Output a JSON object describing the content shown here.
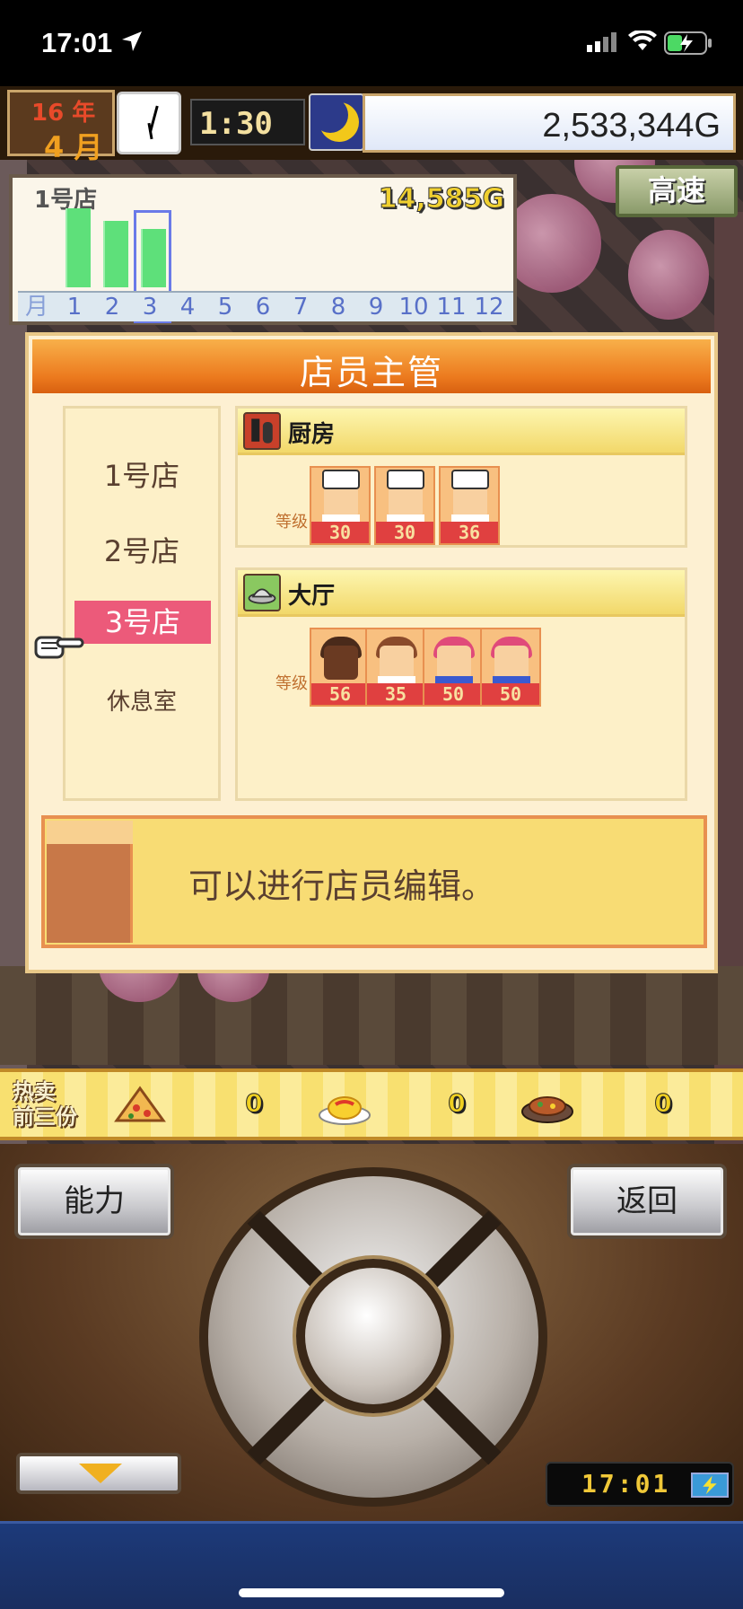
{
  "status_bar": {
    "time": "17:01",
    "icons": [
      "location-arrow-icon",
      "cellular-signal-icon",
      "wifi-icon",
      "battery-charging-icon"
    ]
  },
  "hud": {
    "year": "16 年",
    "month": "4 月",
    "time": "1:30",
    "money": "2,533,344G",
    "weather_icon": "moon-icon"
  },
  "sales_panel": {
    "store": "1号店",
    "total": "14,585G",
    "axis_label": "月",
    "months": [
      "1",
      "2",
      "3",
      "4",
      "5",
      "6",
      "7",
      "8",
      "9",
      "10",
      "11",
      "12"
    ],
    "monthly_sales_fraction": [
      1.0,
      0.84,
      0.74
    ],
    "selected_month": "3"
  },
  "speed_button": "高速",
  "dialog": {
    "title": "店员主管",
    "shops": [
      "1号店",
      "2号店",
      "3号店",
      "休息室"
    ],
    "selected_shop": "3号店",
    "kitchen": {
      "label": "厨房",
      "level_label": "等级",
      "staff_levels": [
        "30",
        "30",
        "36"
      ]
    },
    "hall": {
      "label": "大厅",
      "level_label": "等级",
      "staff_levels": [
        "56",
        "35",
        "50",
        "50"
      ]
    },
    "message": "可以进行店员编辑。"
  },
  "bestsellers": {
    "label_line1": "热卖",
    "label_line2": "前三份",
    "items": [
      {
        "icon": "pizza-icon",
        "count": "0"
      },
      {
        "icon": "omelette-icon",
        "count": "0"
      },
      {
        "icon": "steak-icon",
        "count": "0"
      }
    ]
  },
  "controls": {
    "ability_button": "能力",
    "back_button": "返回",
    "clock": "17:01"
  }
}
